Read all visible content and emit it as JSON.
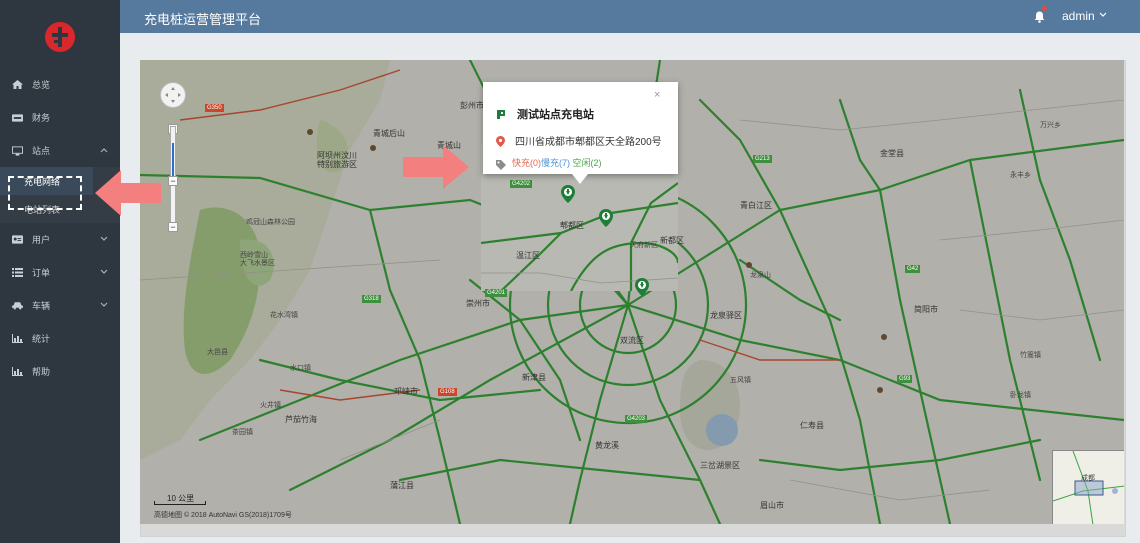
{
  "app": {
    "title": "充电桩运营管理平台",
    "user": "admin"
  },
  "sidebar": {
    "items": [
      {
        "label": "总览",
        "icon": "home-icon"
      },
      {
        "label": "财务",
        "icon": "visa-card-icon"
      },
      {
        "label": "站点",
        "icon": "monitor-icon",
        "expanded": true
      },
      {
        "label": "用户",
        "icon": "id-card-icon"
      },
      {
        "label": "订单",
        "icon": "list-icon"
      },
      {
        "label": "车辆",
        "icon": "car-icon"
      },
      {
        "label": "统计",
        "icon": "bar-chart-icon"
      },
      {
        "label": "帮助",
        "icon": "bar-chart-icon"
      }
    ],
    "sub_items": [
      {
        "label": "充电网络",
        "active": true
      },
      {
        "label": "电站列表",
        "active": false
      }
    ]
  },
  "map": {
    "scale_label": "10 公里",
    "attribution": "高德地图 © 2018 AutoNavi GS(2018)1709号",
    "minimap_label": "成都",
    "city_label": "成都",
    "labels": [
      "青城后山",
      "阿坝州汶川",
      "特别旅游区",
      "青城山",
      "鸡冠山森林公园",
      "西岭雪山",
      "大飞水景区",
      "花水湾镇",
      "大邑县",
      "水口镇",
      "芦茄竹海",
      "火井镇",
      "茶园镇",
      "崇州市",
      "温江区",
      "龙泉驿区",
      "彭州市",
      "郫都区",
      "新都区",
      "青白江区",
      "双流区",
      "新津县",
      "邛崃市",
      "蒲江县",
      "眉山市",
      "简阳市",
      "三岔湖景区",
      "黄龙溪",
      "龙泉山",
      "五风镇",
      "仁寿县",
      "永丰乡",
      "金堂县",
      "万兴乡",
      "竹篙镇",
      "卧龙镇",
      "天府新区"
    ],
    "road_badges": [
      "G350",
      "G4202",
      "G4201",
      "G4203",
      "G42",
      "G5",
      "G93",
      "G108",
      "G213",
      "G318"
    ]
  },
  "popup": {
    "title": "测试站点充电站",
    "address": "四川省成都市郫都区天全路200号",
    "fast": "快充(0)",
    "slow": "慢充(7)",
    "free": "空闲(2)",
    "close": "×"
  },
  "colors": {
    "sidebar_bg": "#2e363f",
    "header_bg": "#56799e",
    "arrow": "#f47f7f",
    "fast": "#e7674d",
    "slow": "#4d95d6",
    "free": "#4aa44a",
    "road": "#3aa43a"
  }
}
